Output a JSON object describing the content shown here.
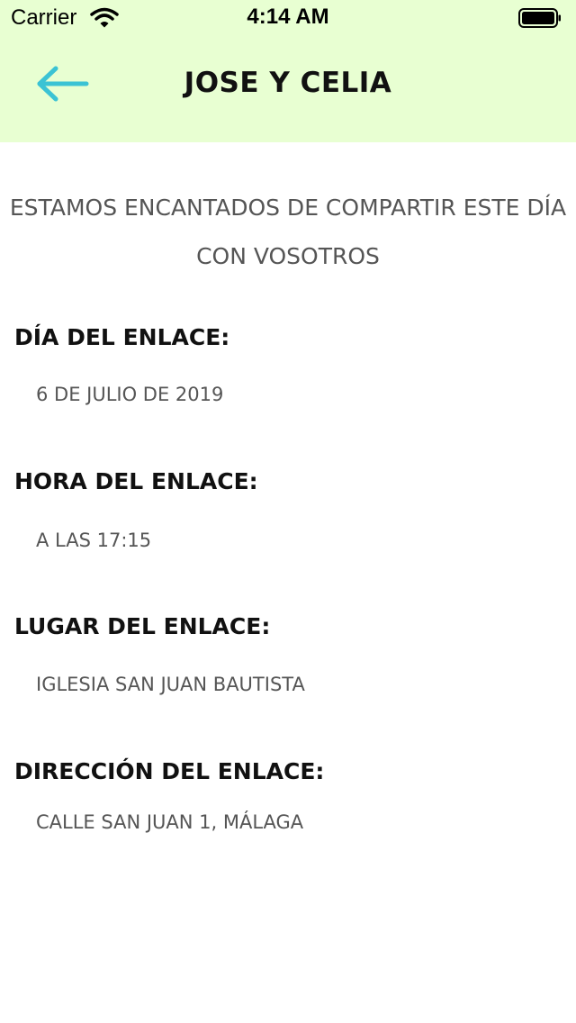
{
  "status_bar": {
    "carrier": "Carrier",
    "time": "4:14 AM"
  },
  "header": {
    "title": "JOSE Y CELIA",
    "back_icon": "arrow-left-icon",
    "background_color": "#e8ffd2",
    "back_icon_color": "#3bc3d4"
  },
  "intro": {
    "text": "ESTAMOS ENCANTADOS DE COMPARTIR ESTE DÍA CON VOSOTROS"
  },
  "details": [
    {
      "label": "DÍA DEL ENLACE:",
      "value": "6 DE JULIO DE 2019"
    },
    {
      "label": "HORA DEL ENLACE:",
      "value": "A LAS 17:15"
    },
    {
      "label": "LUGAR DEL ENLACE:",
      "value": "IGLESIA SAN JUAN BAUTISTA"
    },
    {
      "label": "DIRECCIÓN DEL ENLACE:",
      "value": "CALLE SAN JUAN 1, MÁLAGA"
    }
  ]
}
